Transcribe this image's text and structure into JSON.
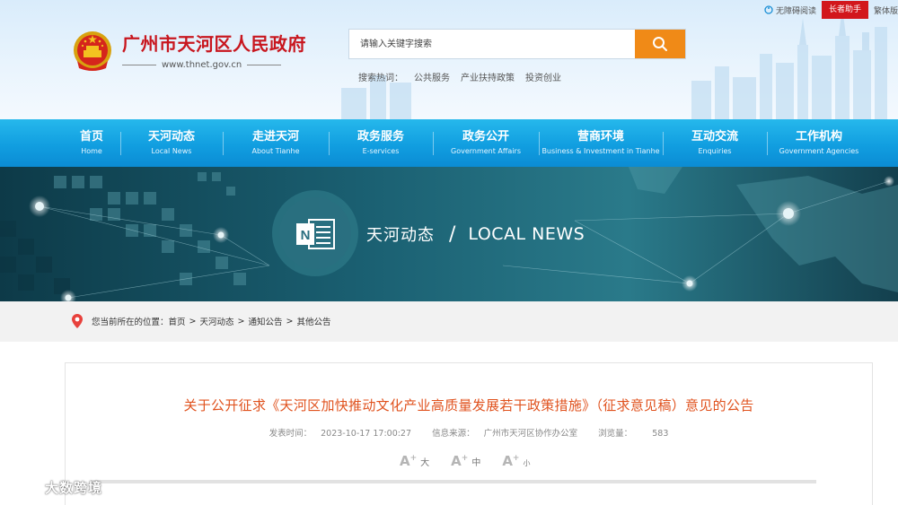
{
  "topbar": {
    "accessibility_label": "无障碍阅读",
    "elder_label": "长者助手",
    "traditional_label": "繁体版"
  },
  "site": {
    "name": "广州市天河区人民政府",
    "url": "www.thnet.gov.cn"
  },
  "search": {
    "placeholder": "请输入关键字搜索",
    "hot_label": "搜索热词：",
    "hot_terms": [
      "公共服务",
      "产业扶持政策",
      "投资创业"
    ]
  },
  "nav": [
    {
      "cn": "首页",
      "en": "Home"
    },
    {
      "cn": "天河动态",
      "en": "Local News"
    },
    {
      "cn": "走进天河",
      "en": "About Tianhe"
    },
    {
      "cn": "政务服务",
      "en": "E-services"
    },
    {
      "cn": "政务公开",
      "en": "Government Affairs"
    },
    {
      "cn": "营商环境",
      "en": "Business & Investment in Tianhe"
    },
    {
      "cn": "互动交流",
      "en": "Enquiries"
    },
    {
      "cn": "工作机构",
      "en": "Government Agencies"
    }
  ],
  "banner": {
    "title_cn": "天河动态",
    "slash": "/",
    "title_en": "LOCAL NEWS"
  },
  "breadcrumb": {
    "label": "您当前所在的位置：",
    "items": [
      "首页",
      "天河动态",
      "通知公告",
      "其他公告"
    ],
    "separator": ">"
  },
  "article": {
    "title": "关于公开征求《天河区加快推动文化产业高质量发展若干政策措施》（征求意见稿）意见的公告",
    "publish_time_label": "发表时间：",
    "publish_time": "2023-10-17 17:00:27",
    "source_label": "信息来源：",
    "source": "广州市天河区协作办公室",
    "views_label": "浏览量：",
    "views": "583",
    "font_sizes": [
      {
        "a": "A",
        "plus": "+",
        "label": "大"
      },
      {
        "a": "A",
        "plus": "+",
        "label": "中"
      },
      {
        "a": "A",
        "plus": "+",
        "label": "小"
      }
    ]
  },
  "watermark": {
    "text": "大数跨境"
  },
  "colors": {
    "brand_red": "#c8161e",
    "search_orange": "#f08a17",
    "nav_blue": "#119ee0",
    "title_orange": "#e0521e"
  }
}
